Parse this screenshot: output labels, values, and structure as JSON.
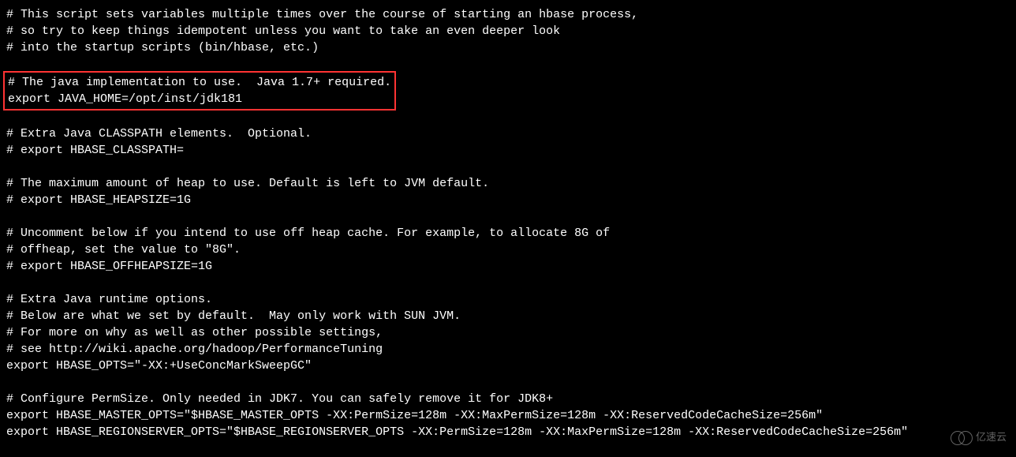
{
  "terminal": {
    "lines": [
      "# This script sets variables multiple times over the course of starting an hbase process,",
      "# so try to keep things idempotent unless you want to take an even deeper look",
      "# into the startup scripts (bin/hbase, etc.)",
      "",
      "HIGHLIGHT_START",
      "# The java implementation to use.  Java 1.7+ required.",
      "export JAVA_HOME=/opt/inst/jdk181",
      "HIGHLIGHT_END",
      "",
      "# Extra Java CLASSPATH elements.  Optional.",
      "# export HBASE_CLASSPATH=",
      "",
      "# The maximum amount of heap to use. Default is left to JVM default.",
      "# export HBASE_HEAPSIZE=1G",
      "",
      "# Uncomment below if you intend to use off heap cache. For example, to allocate 8G of",
      "# offheap, set the value to \"8G\".",
      "# export HBASE_OFFHEAPSIZE=1G",
      "",
      "# Extra Java runtime options.",
      "# Below are what we set by default.  May only work with SUN JVM.",
      "# For more on why as well as other possible settings,",
      "# see http://wiki.apache.org/hadoop/PerformanceTuning",
      "export HBASE_OPTS=\"-XX:+UseConcMarkSweepGC\"",
      "",
      "# Configure PermSize. Only needed in JDK7. You can safely remove it for JDK8+",
      "export HBASE_MASTER_OPTS=\"$HBASE_MASTER_OPTS -XX:PermSize=128m -XX:MaxPermSize=128m -XX:ReservedCodeCacheSize=256m\"",
      "export HBASE_REGIONSERVER_OPTS=\"$HBASE_REGIONSERVER_OPTS -XX:PermSize=128m -XX:MaxPermSize=128m -XX:ReservedCodeCacheSize=256m\""
    ]
  },
  "watermark": {
    "text": "亿速云"
  }
}
